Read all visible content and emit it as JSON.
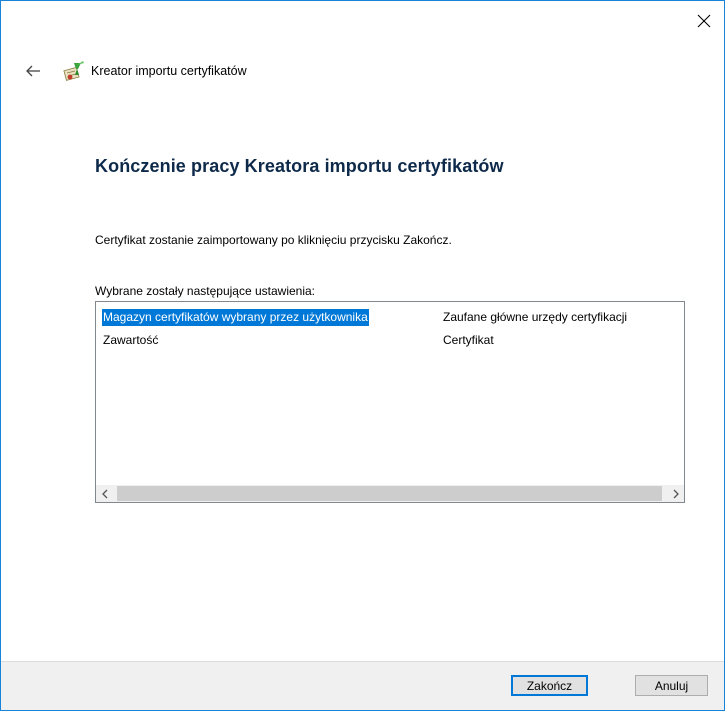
{
  "window": {
    "close_glyph": "✕"
  },
  "nav": {
    "back_glyph": "←",
    "title": "Kreator importu certyfikatów"
  },
  "page": {
    "heading": "Kończenie pracy Kreatora importu certyfikatów",
    "info": "Certyfikat zostanie zaimportowany po kliknięciu przycisku Zakończ.",
    "settings_label": "Wybrane zostały następujące ustawienia:"
  },
  "settings_list": {
    "rows": [
      {
        "name": "Magazyn certyfikatów wybrany przez użytkownika",
        "value": "Zaufane główne urzędy certyfikacji",
        "selected": true
      },
      {
        "name": "Zawartość",
        "value": "Certyfikat",
        "selected": false
      }
    ],
    "scroll_left_glyph": "<",
    "scroll_right_glyph": ">"
  },
  "footer": {
    "finish_label": "Zakończ",
    "cancel_label": "Anuluj"
  },
  "colors": {
    "accent": "#0078d7",
    "window_border": "#1883d7",
    "heading": "#0e2a4a",
    "footer_bg": "#f0f0f0"
  },
  "icons": {
    "close": "close-icon",
    "back": "back-arrow-icon",
    "wizard": "certificate-wizard-icon"
  }
}
